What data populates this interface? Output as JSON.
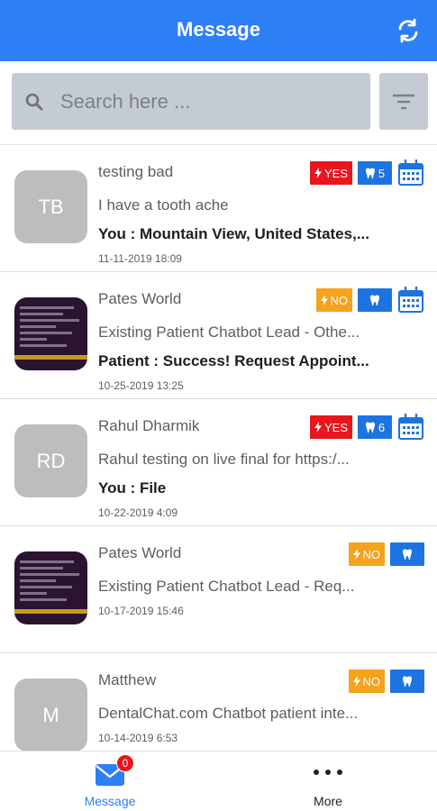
{
  "header": {
    "title": "Message"
  },
  "search": {
    "placeholder": "Search here ..."
  },
  "messages": [
    {
      "avatar_type": "initials",
      "initials": "TB",
      "name": "testing bad",
      "subject": "I have a tooth ache",
      "last_message": "You : Mountain View, United States,...",
      "date": "11-11-2019  18:09",
      "lead_status": "YES",
      "tooth_count": "5",
      "has_calendar": true
    },
    {
      "avatar_type": "image",
      "initials": "",
      "name": "Pates World",
      "subject": "Existing Patient Chatbot Lead - Othe...",
      "last_message": "Patient : Success! Request Appoint...",
      "date": "10-25-2019  13:25",
      "lead_status": "NO",
      "tooth_count": "",
      "has_calendar": true
    },
    {
      "avatar_type": "initials",
      "initials": "RD",
      "name": "Rahul Dharmik",
      "subject": "Rahul testing on live final for  https:/...",
      "last_message": "You : File",
      "date": "10-22-2019  4:09",
      "lead_status": "YES",
      "tooth_count": "6",
      "has_calendar": true
    },
    {
      "avatar_type": "image",
      "initials": "",
      "name": "Pates World",
      "subject": "Existing Patient Chatbot Lead - Req...",
      "last_message": "",
      "date": "10-17-2019  15:46",
      "lead_status": "NO",
      "tooth_count": "",
      "has_calendar": false
    },
    {
      "avatar_type": "initials",
      "initials": "M",
      "name": "Matthew",
      "subject": "DentalChat.com Chatbot patient inte...",
      "last_message": "",
      "date": "10-14-2019  6:53",
      "lead_status": "NO",
      "tooth_count": "",
      "has_calendar": false
    }
  ],
  "bottom_nav": {
    "message_label": "Message",
    "message_badge": "0",
    "more_label": "More"
  },
  "colors": {
    "primary": "#2d7ff5",
    "yes": "#e8161d",
    "no": "#f5a21d",
    "tooth": "#1d74e0"
  },
  "icons": [
    "refresh-icon",
    "search-icon",
    "filter-icon",
    "bolt-icon",
    "tooth-icon",
    "calendar-icon",
    "mail-icon",
    "more-dots-icon"
  ]
}
